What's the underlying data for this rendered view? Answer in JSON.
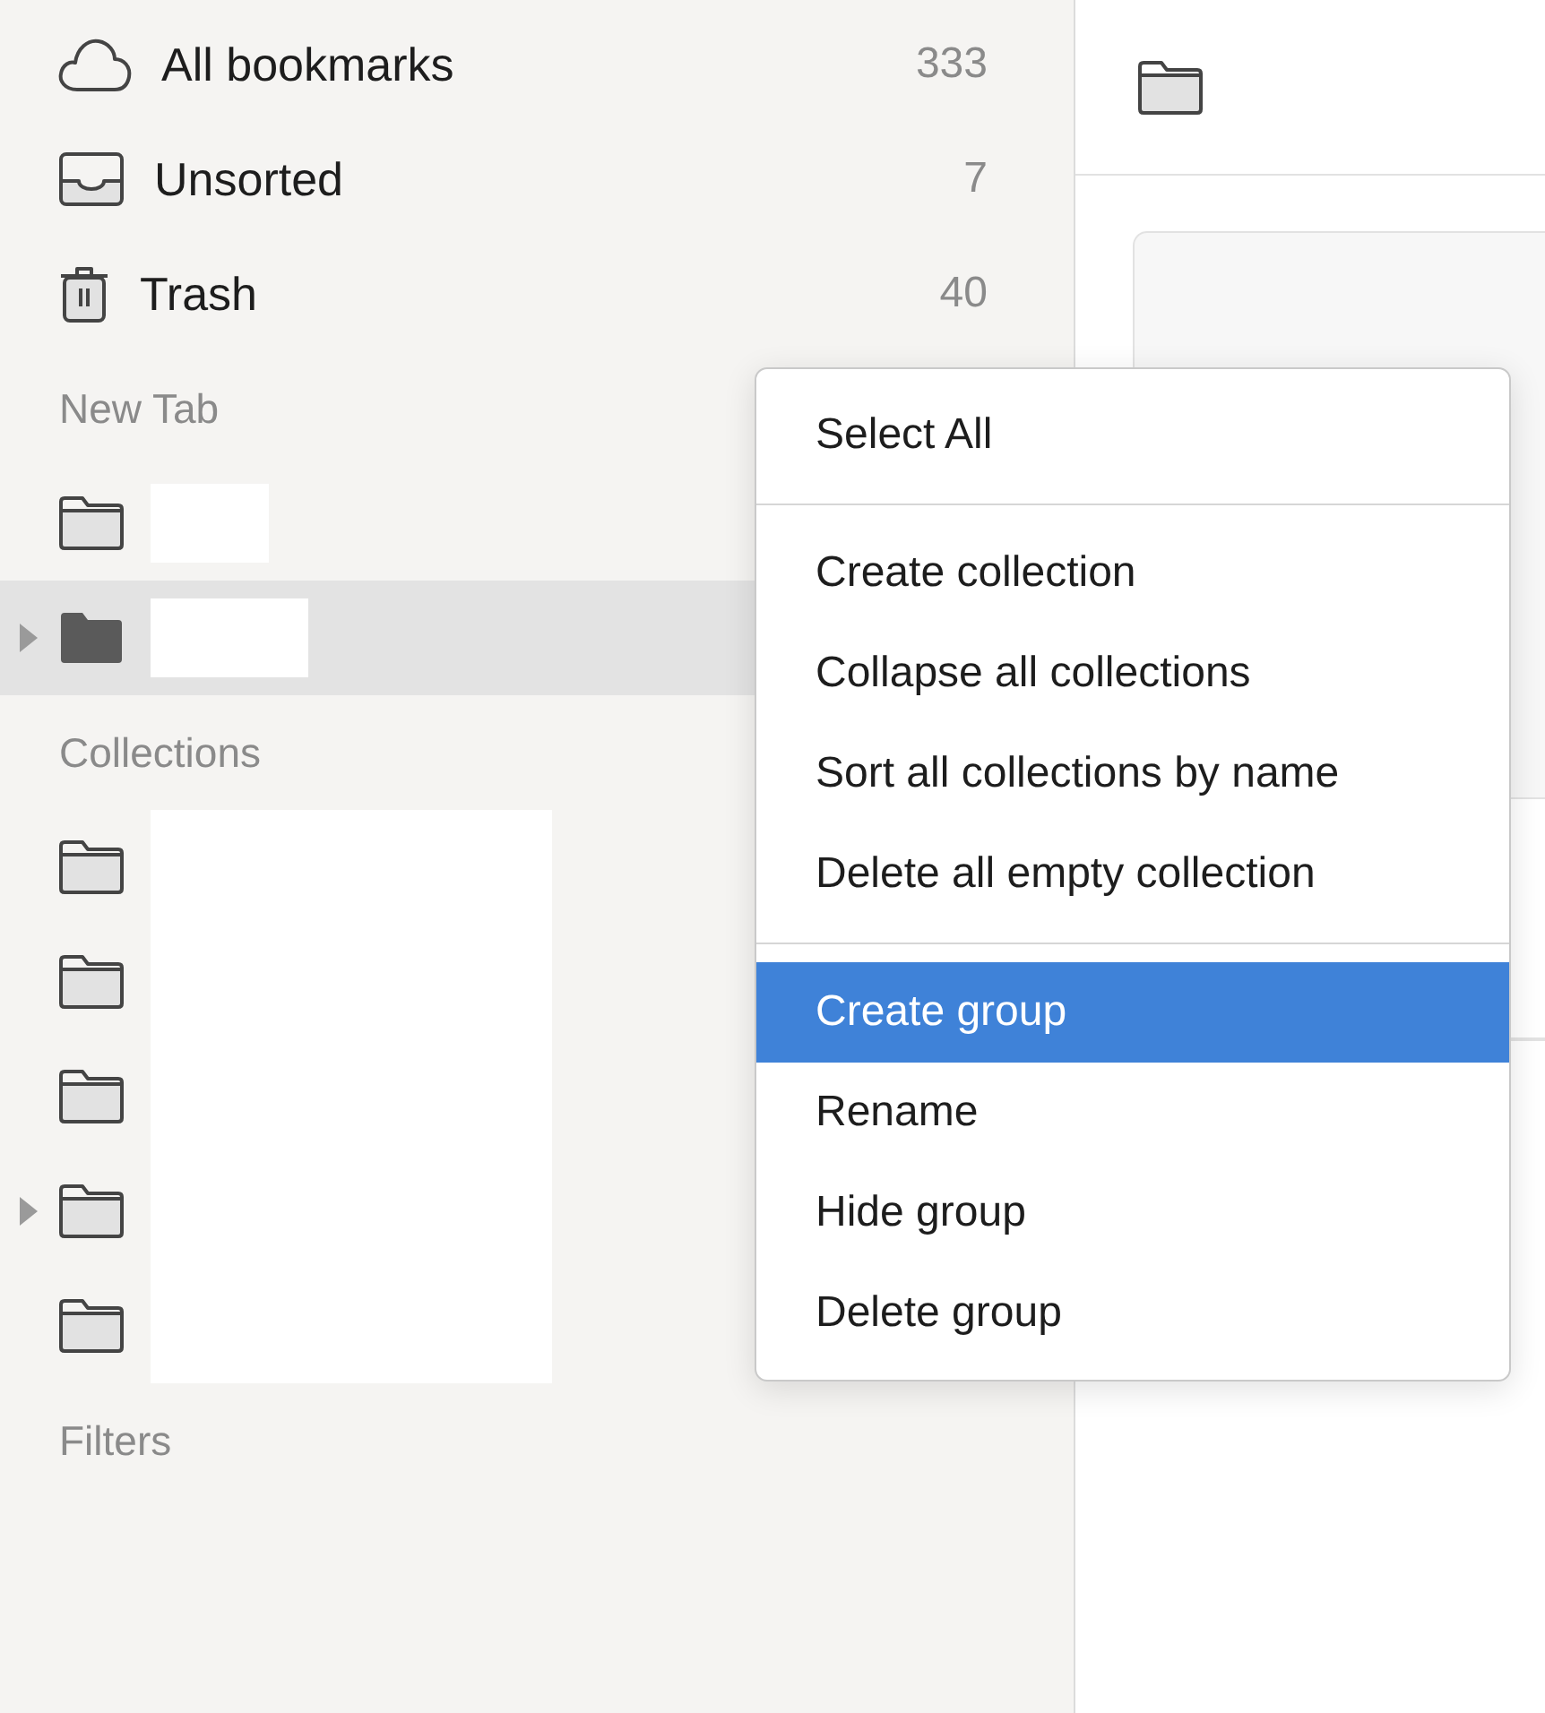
{
  "sidebar": {
    "system_items": [
      {
        "label": "All bookmarks",
        "count": "333"
      },
      {
        "label": "Unsorted",
        "count": "7"
      },
      {
        "label": "Trash",
        "count": "40"
      }
    ],
    "groups": [
      {
        "title": "New Tab",
        "items": [
          {
            "redacted": true,
            "expandable": false,
            "selected": false
          },
          {
            "redacted": true,
            "expandable": true,
            "selected": true
          }
        ]
      },
      {
        "title": "Collections",
        "items": [
          {
            "redacted": true,
            "expandable": false,
            "selected": false
          },
          {
            "redacted": true,
            "expandable": false,
            "selected": false
          },
          {
            "redacted": true,
            "expandable": false,
            "selected": false
          },
          {
            "redacted": true,
            "expandable": true,
            "selected": false
          },
          {
            "redacted": true,
            "expandable": false,
            "selected": false
          }
        ]
      },
      {
        "title": "Filters"
      }
    ]
  },
  "context_menu": {
    "sections": [
      [
        {
          "label": "Select All",
          "selected": false
        }
      ],
      [
        {
          "label": "Create collection",
          "selected": false
        },
        {
          "label": "Collapse all collections",
          "selected": false
        },
        {
          "label": "Sort all collections by name",
          "selected": false
        },
        {
          "label": "Delete all empty collection",
          "selected": false
        }
      ],
      [
        {
          "label": "Create group",
          "selected": true
        },
        {
          "label": "Rename",
          "selected": false
        },
        {
          "label": "Hide group",
          "selected": false
        },
        {
          "label": "Delete group",
          "selected": false
        }
      ]
    ]
  }
}
